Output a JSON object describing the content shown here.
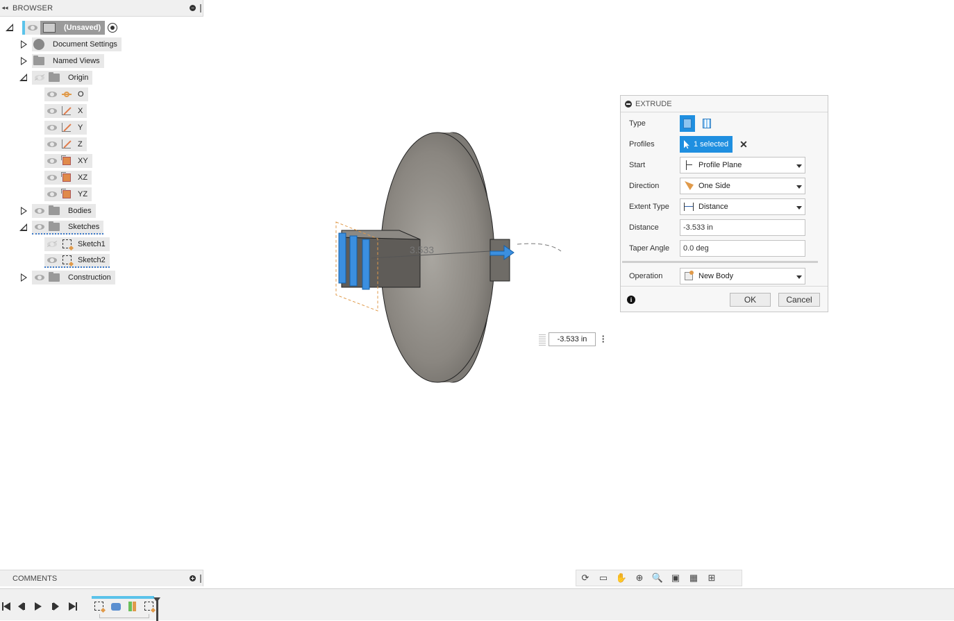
{
  "browser": {
    "title": "BROWSER",
    "root": "(Unsaved)",
    "items": [
      {
        "label": "Document Settings"
      },
      {
        "label": "Named Views"
      },
      {
        "label": "Origin"
      },
      {
        "label": "O"
      },
      {
        "label": "X"
      },
      {
        "label": "Y"
      },
      {
        "label": "Z"
      },
      {
        "label": "XY"
      },
      {
        "label": "XZ"
      },
      {
        "label": "YZ"
      },
      {
        "label": "Bodies"
      },
      {
        "label": "Sketches"
      },
      {
        "label": "Sketch1"
      },
      {
        "label": "Sketch2"
      },
      {
        "label": "Construction"
      }
    ]
  },
  "viewport": {
    "dimension_label": "3.533",
    "distance_value": "-3.533 in"
  },
  "extrude": {
    "title": "EXTRUDE",
    "type_label": "Type",
    "profiles_label": "Profiles",
    "profiles_value": "1 selected",
    "start_label": "Start",
    "start_value": "Profile Plane",
    "direction_label": "Direction",
    "direction_value": "One Side",
    "extent_label": "Extent Type",
    "extent_value": "Distance",
    "distance_label": "Distance",
    "distance_value": "-3.533 in",
    "taper_label": "Taper Angle",
    "taper_value": "0.0 deg",
    "operation_label": "Operation",
    "operation_value": "New Body",
    "ok_label": "OK",
    "cancel_label": "Cancel"
  },
  "comments": {
    "title": "COMMENTS"
  },
  "colors": {
    "accent": "#1f8fe0",
    "timeline_strip": "#5bc3ea",
    "body": "#8a8680",
    "origin": "#e09a4a"
  }
}
